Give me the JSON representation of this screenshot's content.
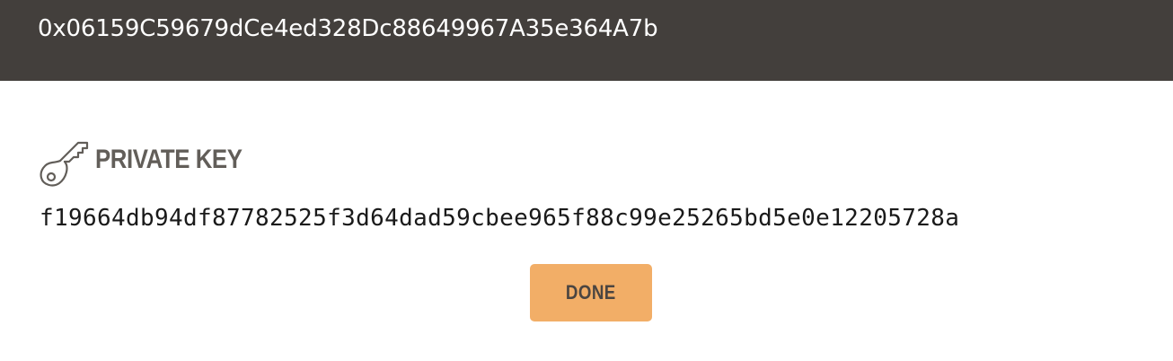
{
  "header": {
    "address": "0x06159C59679dCe4ed328Dc88649967A35e364A7b"
  },
  "private_key_section": {
    "icon": "key-icon",
    "label": "PRIVATE KEY",
    "value": "f19664db94df87782525f3d64dad59cbee965f88c99e25265bd5e0e12205728a"
  },
  "actions": {
    "done_label": "DONE"
  },
  "colors": {
    "header_bg": "#433f3c",
    "accent": "#f2ae67",
    "label": "#625e59"
  }
}
